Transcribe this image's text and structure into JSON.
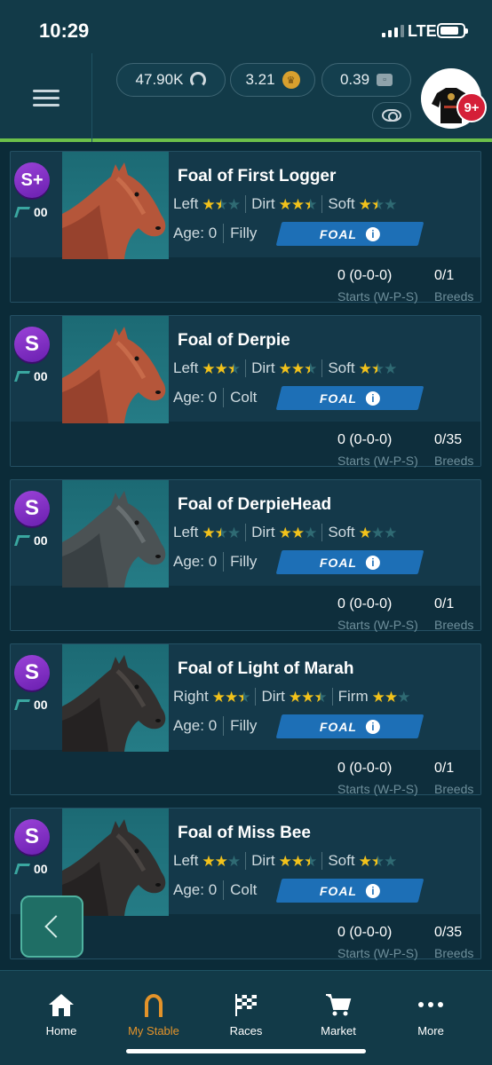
{
  "status_bar": {
    "time": "10:29",
    "network": "LTE"
  },
  "header": {
    "currencies": [
      {
        "value": "47.90K",
        "icon": "horseshoe-coin-icon"
      },
      {
        "value": "3.21",
        "icon": "crown-coin-icon"
      },
      {
        "value": "0.39",
        "icon": "ticket-icon"
      }
    ],
    "notification_badge": "9+"
  },
  "horses": [
    {
      "grade": "S+",
      "speed": "00",
      "name": "Foal of First Logger",
      "coat": "chestnut",
      "surfaces": [
        {
          "label": "Left",
          "rating": 1.5
        },
        {
          "label": "Dirt",
          "rating": 2.5
        },
        {
          "label": "Soft",
          "rating": 1.5
        }
      ],
      "age": "Age: 0",
      "sex": "Filly",
      "tag": "FOAL",
      "record": "0 (0-0-0)",
      "record_label": "Starts (W-P-S)",
      "breeds": "0/1",
      "breeds_label": "Breeds"
    },
    {
      "grade": "S",
      "speed": "00",
      "name": "Foal of Derpie",
      "coat": "chestnut",
      "surfaces": [
        {
          "label": "Left",
          "rating": 2.5
        },
        {
          "label": "Dirt",
          "rating": 2.5
        },
        {
          "label": "Soft",
          "rating": 1.5
        }
      ],
      "age": "Age: 0",
      "sex": "Colt",
      "tag": "FOAL",
      "record": "0 (0-0-0)",
      "record_label": "Starts (W-P-S)",
      "breeds": "0/35",
      "breeds_label": "Breeds"
    },
    {
      "grade": "S",
      "speed": "00",
      "name": "Foal of DerpieHead",
      "coat": "grey",
      "surfaces": [
        {
          "label": "Left",
          "rating": 1.5
        },
        {
          "label": "Dirt",
          "rating": 2
        },
        {
          "label": "Soft",
          "rating": 1
        }
      ],
      "age": "Age: 0",
      "sex": "Filly",
      "tag": "FOAL",
      "record": "0 (0-0-0)",
      "record_label": "Starts (W-P-S)",
      "breeds": "0/1",
      "breeds_label": "Breeds"
    },
    {
      "grade": "S",
      "speed": "00",
      "name": "Foal of Light of Marah",
      "coat": "dark",
      "surfaces": [
        {
          "label": "Right",
          "rating": 2.5
        },
        {
          "label": "Dirt",
          "rating": 2.5
        },
        {
          "label": "Firm",
          "rating": 2
        }
      ],
      "age": "Age: 0",
      "sex": "Filly",
      "tag": "FOAL",
      "record": "0 (0-0-0)",
      "record_label": "Starts (W-P-S)",
      "breeds": "0/1",
      "breeds_label": "Breeds"
    },
    {
      "grade": "S",
      "speed": "00",
      "name": "Foal of Miss Bee",
      "coat": "dark",
      "surfaces": [
        {
          "label": "Left",
          "rating": 2
        },
        {
          "label": "Dirt",
          "rating": 2.5
        },
        {
          "label": "Soft",
          "rating": 1.5
        }
      ],
      "age": "Age: 0",
      "sex": "Colt",
      "tag": "FOAL",
      "record": "0 (0-0-0)",
      "record_label": "Starts (W-P-S)",
      "breeds": "0/35",
      "breeds_label": "Breeds"
    }
  ],
  "nav": [
    {
      "label": "Home",
      "icon": "home-icon",
      "active": false
    },
    {
      "label": "My Stable",
      "icon": "horseshoe-icon",
      "active": true
    },
    {
      "label": "Races",
      "icon": "checkered-flag-icon",
      "active": false
    },
    {
      "label": "Market",
      "icon": "cart-icon",
      "active": false
    },
    {
      "label": "More",
      "icon": "more-dots-icon",
      "active": false
    }
  ],
  "colors": {
    "accent_green": "#6cc04a",
    "active_nav": "#e3932a",
    "tag_blue": "#1d6fb6",
    "star": "#f2c21b",
    "grade_purple": "#8a34cc"
  }
}
